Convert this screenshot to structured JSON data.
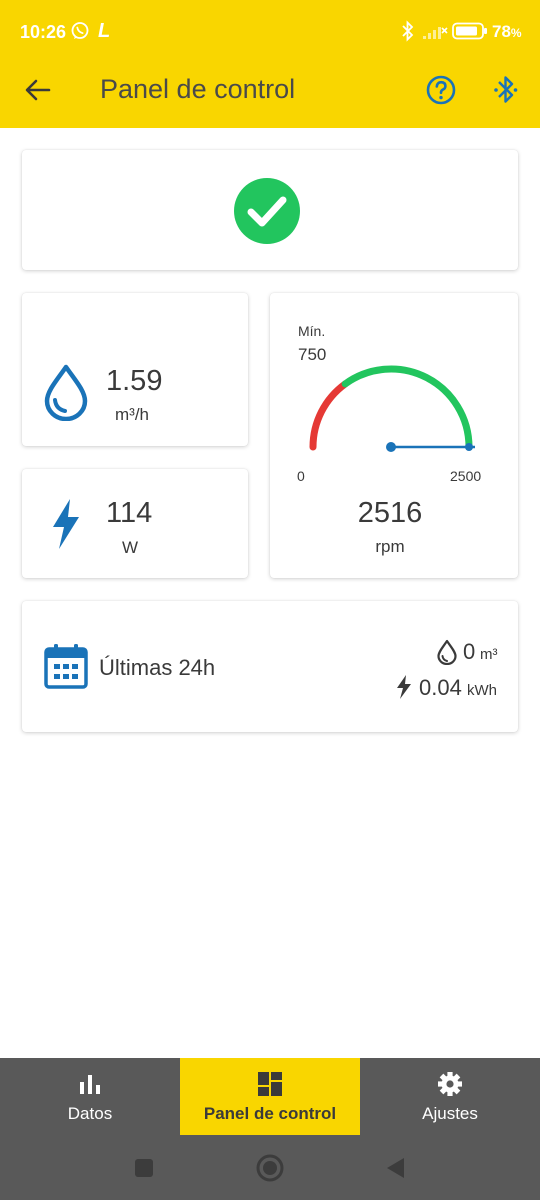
{
  "status_bar": {
    "time": "10:26",
    "carrier_letter": "L",
    "battery": "78"
  },
  "app_bar": {
    "title": "Panel de control"
  },
  "status_card": {
    "icon": "check-circle-icon",
    "color": "#22c55e"
  },
  "flow": {
    "value": "1.59",
    "unit": "m³/h",
    "icon": "water-drop-icon"
  },
  "power": {
    "value": "114",
    "unit": "W",
    "icon": "lightning-icon"
  },
  "gauge": {
    "min_label": "Mín.",
    "min_value": "750",
    "scale_start": "0",
    "scale_end": "2500",
    "value": "2516",
    "unit": "rpm",
    "range_max": 2500,
    "min_threshold": 750,
    "needle_value": 2500,
    "red": "#e53935",
    "green": "#22c55e",
    "needle_color": "#1a73b8"
  },
  "last24": {
    "label": "Últimas 24h",
    "water_value": "0",
    "water_unit": "m³",
    "energy_value": "0.04",
    "energy_unit": "kWh"
  },
  "bottom_nav": {
    "items": [
      {
        "label": "Datos",
        "icon": "bar-chart-icon"
      },
      {
        "label": "Panel de control",
        "icon": "dashboard-icon"
      },
      {
        "label": "Ajustes",
        "icon": "gear-icon"
      }
    ],
    "active": 1
  },
  "colors": {
    "accent": "#f9d600",
    "icon_blue": "#1a73b8",
    "nav_bg": "#595959"
  }
}
